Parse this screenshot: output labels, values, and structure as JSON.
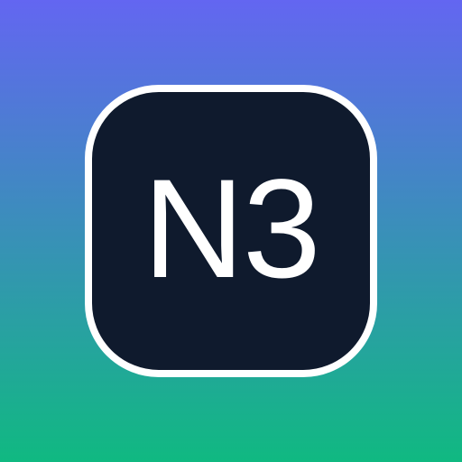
{
  "icon": {
    "text": "N3",
    "colors": {
      "gradient_top": "#6366f1",
      "gradient_bottom": "#10b981",
      "badge_fill": "#0f1a2d",
      "badge_border": "#ffffff",
      "text": "#ffffff"
    }
  }
}
